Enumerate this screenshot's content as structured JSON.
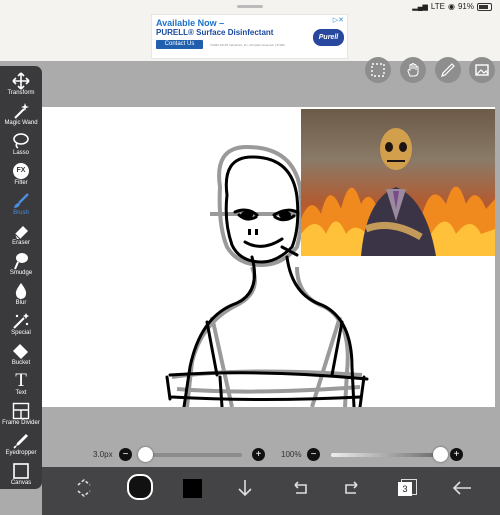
{
  "status": {
    "signal": "LTE",
    "battery": "91%"
  },
  "ad": {
    "title": "Available Now –",
    "subtitle": "PURELL® Surface Disinfectant",
    "button": "Contact Us",
    "fine_print": "©2020 GOJO Industries, Inc. All rights reserved. | 37462",
    "logo": "Purell",
    "choices_icon": "ad-choices-icon"
  },
  "tools": [
    {
      "label": "Transform",
      "icon": "move-arrows-icon"
    },
    {
      "label": "Magic Wand",
      "icon": "magic-wand-icon"
    },
    {
      "label": "Lasso",
      "icon": "lasso-icon"
    },
    {
      "label": "Filter",
      "icon": "fx-icon",
      "glyph": "FX"
    },
    {
      "label": "Brush",
      "icon": "brush-icon",
      "active": true
    },
    {
      "label": "Eraser",
      "icon": "eraser-icon"
    },
    {
      "label": "Smudge",
      "icon": "smudge-icon"
    },
    {
      "label": "Blur",
      "icon": "drop-icon"
    },
    {
      "label": "Special",
      "icon": "sparkle-wand-icon"
    },
    {
      "label": "Bucket",
      "icon": "bucket-icon"
    },
    {
      "label": "Text",
      "icon": "text-icon",
      "glyph": "T"
    },
    {
      "label": "Frame Divider",
      "icon": "frame-divider-icon"
    },
    {
      "label": "Eyedropper",
      "icon": "eyedropper-icon"
    },
    {
      "label": "Canvas",
      "icon": "canvas-icon"
    }
  ],
  "top_icons": [
    "selection-icon",
    "hand-icon",
    "pencil-icon",
    "image-icon"
  ],
  "brush": {
    "size_label": "3.0px",
    "size_fraction": 0.02,
    "opacity_label": "100%",
    "opacity_fraction": 1.0
  },
  "bottom": {
    "items": [
      "swap-transform-icon",
      "color-swatch-icon",
      "square-icon",
      "arrow-down-icon",
      "undo-icon",
      "redo-icon",
      "layers-icon",
      "back-arrow-icon"
    ],
    "layer_count": "3",
    "color": "#111111"
  }
}
